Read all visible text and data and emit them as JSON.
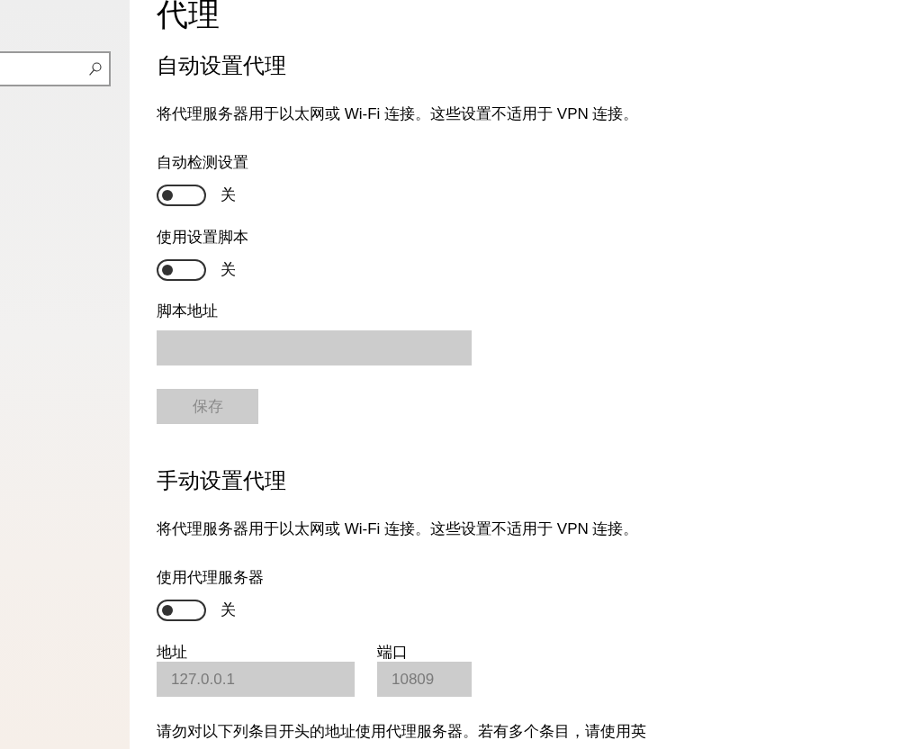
{
  "page_title": "代理",
  "sections": [
    {
      "heading": "自动设置代理",
      "description": "将代理服务器用于以太网或 Wi-Fi 连接。这些设置不适用于 VPN 连接。",
      "controls": [
        {
          "kind": "toggle",
          "label": "自动检测设置",
          "on": false,
          "status": "关"
        },
        {
          "kind": "toggle",
          "label": "使用设置脚本",
          "on": false,
          "status": "关"
        },
        {
          "kind": "field",
          "label": "脚本地址",
          "disabled": true
        },
        {
          "kind": "button",
          "label": "保存",
          "disabled": true
        }
      ]
    },
    {
      "heading": "手动设置代理",
      "description": "将代理服务器用于以太网或 Wi-Fi 连接。这些设置不适用于 VPN 连接。",
      "controls": [
        {
          "kind": "toggle",
          "label": "使用代理服务器",
          "on": false,
          "status": "关"
        },
        {
          "kind": "field_pair",
          "fields": [
            {
              "label": "地址",
              "value": "127.0.0.1",
              "disabled": true
            },
            {
              "label": "端口",
              "value": "10809",
              "disabled": true
            }
          ]
        },
        {
          "kind": "paragraph",
          "text": "请勿对以下列条目开头的地址使用代理服务器。若有多个条目，请使用英"
        }
      ]
    }
  ]
}
